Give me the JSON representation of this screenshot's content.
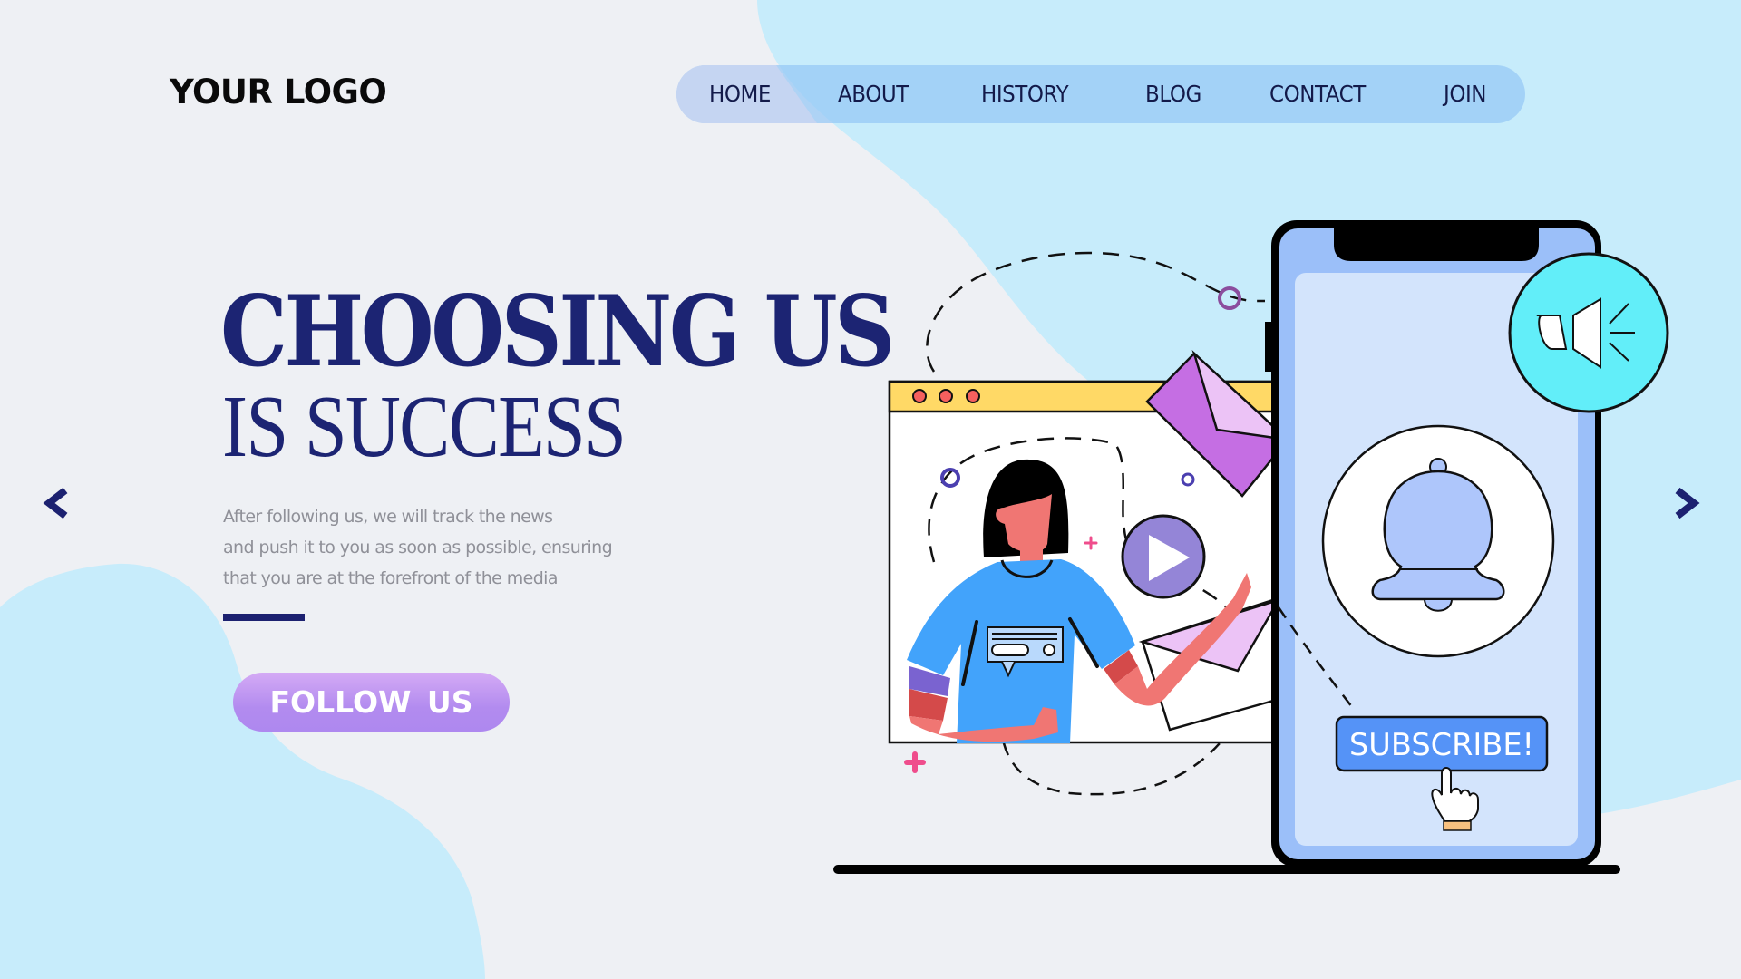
{
  "logo": {
    "text": "YOUR LOGO"
  },
  "nav": {
    "items": [
      {
        "label": "HOME",
        "active": true
      },
      {
        "label": "ABOUT",
        "active": false
      },
      {
        "label": "HISTORY",
        "active": false
      },
      {
        "label": "BLOG",
        "active": false
      },
      {
        "label": "CONTACT",
        "active": false
      },
      {
        "label": "JOIN",
        "active": false
      }
    ]
  },
  "hero": {
    "headline_line1": "CHOOSING US",
    "headline_line2": "IS SUCCESS",
    "description_lines": [
      "After following us, we will track the news",
      "and push it to you as soon as possible, ensuring",
      "that you are at the forefront of the media"
    ],
    "cta_label": "FOLLOW  US"
  },
  "carousel": {
    "prev_icon": "chevron-left-icon",
    "next_icon": "chevron-right-icon"
  },
  "illustration": {
    "subscribe_label": "SUBSCRIBE!",
    "icons": [
      "browser-window",
      "person-presenting",
      "play-icon",
      "envelope-icon",
      "smartphone",
      "speaker-icon",
      "bell-icon",
      "hand-pointer-icon"
    ]
  },
  "colors": {
    "background": "#eef0f4",
    "blob": "#c7ecfb",
    "nav_pill": "#a3d4f8",
    "nav_active": "#c5d5f2",
    "headline": "#1c2473",
    "body_text": "#8f9098",
    "cta_gradient_top": "#d4aaf5",
    "cta_gradient_bottom": "#ae88ef",
    "phone_frame": "#9bbff9",
    "phone_screen": "#d3e4fc",
    "speaker_circle": "#62eef9",
    "subscribe_button": "#5593f7",
    "browser_bar": "#ffd966",
    "envelope": "#c56ee3",
    "play_circle": "#9485d7",
    "shirt": "#42a3fb",
    "skin": "#f07673"
  }
}
